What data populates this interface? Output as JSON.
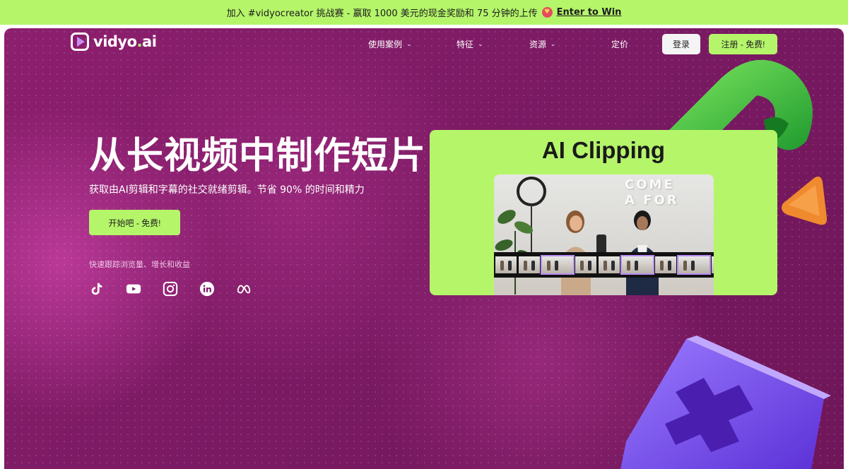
{
  "announcement": {
    "text": "加入 #vidyocreator 挑战赛 - 赢取 1000 美元的现金奖励和 75 分钟的上传",
    "emoji": "😍",
    "link": "Enter to Win"
  },
  "brand": {
    "name_main": "vidyo",
    "name_dot": ".",
    "name_tld": "ai"
  },
  "nav": {
    "items": [
      {
        "label": "使用案例",
        "has_dropdown": true
      },
      {
        "label": "特征",
        "has_dropdown": true
      },
      {
        "label": "资源",
        "has_dropdown": true
      },
      {
        "label": "定价",
        "has_dropdown": false
      }
    ],
    "chevron": "⌄",
    "login": "登录",
    "signup": "注册 - 免费!"
  },
  "hero": {
    "headline": "从长视频中制作短片",
    "subheadline": "获取由AI剪辑和字幕的社交就绪剪辑。节省 90% 的时间和精力",
    "cta": "开始吧 - 免费!",
    "tagline": "快速跟踪浏览量、增长和收益",
    "socials": [
      "tiktok-icon",
      "youtube-icon",
      "instagram-icon",
      "linkedin-icon",
      "meta-icon"
    ]
  },
  "card": {
    "title": "AI Clipping",
    "video_wall_text": "COME A FOR"
  },
  "colors": {
    "accent": "#b5f56a",
    "hero_bg": "#7a1a63",
    "text_dark": "#1c1c1c"
  }
}
